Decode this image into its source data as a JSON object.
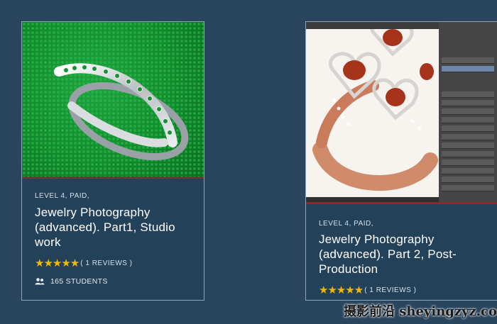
{
  "courses": [
    {
      "meta": "LEVEL 4, PAID,",
      "title": "Jewelry Photography (advanced). Part1, Studio work",
      "stars": "★★★★★",
      "reviews": "( 1 REVIEWS )",
      "students": "165 STUDENTS",
      "rating": 5
    },
    {
      "meta": "LEVEL 4, PAID,",
      "title": "Jewelry Photography (advanced). Part 2, Post-Production",
      "stars": "★★★★★",
      "reviews": "( 1 REVIEWS )",
      "rating": 5
    }
  ],
  "watermark": "摄影前沿 sheyingzyz.co",
  "colors": {
    "background": "#2a465e",
    "card": "#24415a",
    "star": "#f5b800",
    "accent": "#8a2a2a"
  }
}
